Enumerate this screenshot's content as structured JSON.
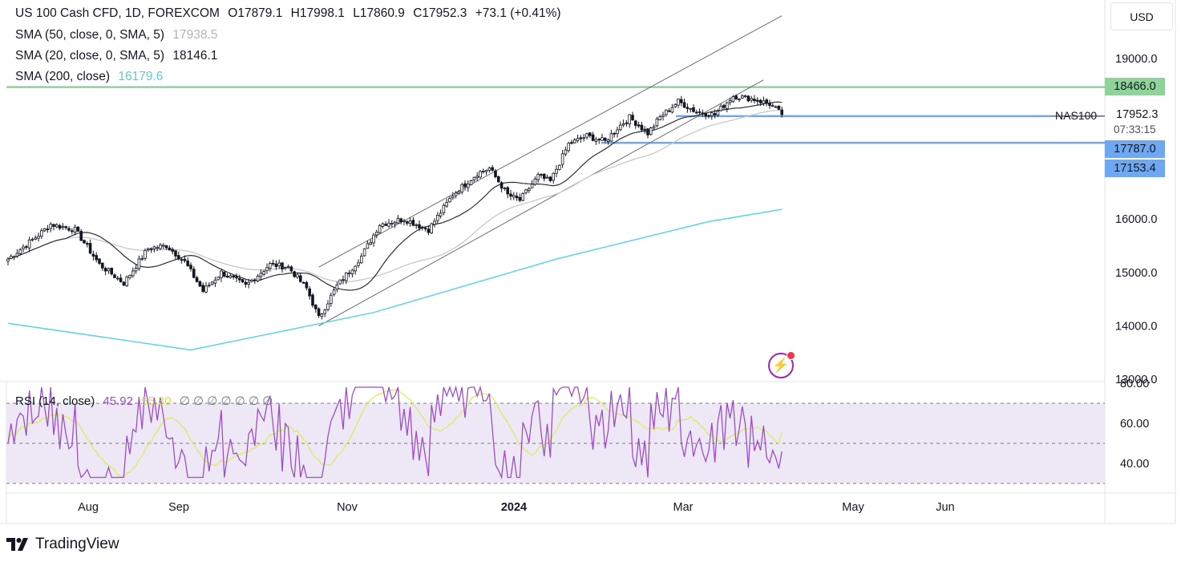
{
  "header": {
    "symbol": "US 100 Cash CFD, 1D, FOREXCOM",
    "open": "O17879.1",
    "high": "H17998.1",
    "low": "L17860.9",
    "close": "C17952.3",
    "change": "+73.1 (+0.41%)",
    "sma50_label": "SMA (50, close, 0, SMA, 5)",
    "sma50_value": "17938.5",
    "sma20_label": "SMA (20, close, 0, SMA, 5)",
    "sma20_value": "18146.1",
    "sma200_label": "SMA (200, close)",
    "sma200_value": "16179.6"
  },
  "rsi_legend": {
    "label": "RSI (14, close)",
    "rsi_value": "45.92",
    "ma_value": "55.30",
    "empty_values": "∅ ∅ ∅ ∅ ∅ ∅ ∅"
  },
  "currency_button": "USD",
  "price_tags": {
    "resistance": "18466.0",
    "last_price": "17952.3",
    "countdown": "07:33:15",
    "support1": "17787.0",
    "support2": "17153.4",
    "symbol_label": "NAS100"
  },
  "price_axis": [
    "19000.0",
    "16000.0",
    "15000.0",
    "14000.0",
    "13000.0"
  ],
  "rsi_axis": [
    "80.00",
    "60.00",
    "40.00"
  ],
  "time_axis": [
    "Aug",
    "Sep",
    "Nov",
    "2024",
    "Mar",
    "May",
    "Jun"
  ],
  "branding": "TradingView",
  "colors": {
    "up": "#131722",
    "down": "#131722",
    "sma20": "#2a2e39",
    "sma50": "#c8c8c8",
    "sma200": "#5dd3e8",
    "resistance": "#8fd39a",
    "support": "#6fa8f0",
    "rsi": "#9c4fc4",
    "rsi_ma": "#dcec5c",
    "rsi_band": "#ede7f6"
  },
  "chart_data": {
    "type": "candlestick",
    "title": "US 100 Cash CFD, 1D, FOREXCOM",
    "y_range": [
      12900,
      19500
    ],
    "x_labels": [
      "Aug",
      "Sep",
      "Nov",
      "2024",
      "Mar",
      "May",
      "Jun"
    ],
    "anchors": [
      {
        "i": 0,
        "c": 15250
      },
      {
        "i": 10,
        "c": 15700
      },
      {
        "i": 14,
        "c": 15900
      },
      {
        "i": 22,
        "c": 15800
      },
      {
        "i": 30,
        "c": 15150
      },
      {
        "i": 38,
        "c": 14800
      },
      {
        "i": 46,
        "c": 15450
      },
      {
        "i": 52,
        "c": 15500
      },
      {
        "i": 58,
        "c": 15200
      },
      {
        "i": 64,
        "c": 14650
      },
      {
        "i": 70,
        "c": 15000
      },
      {
        "i": 78,
        "c": 14750
      },
      {
        "i": 86,
        "c": 15150
      },
      {
        "i": 92,
        "c": 15100
      },
      {
        "i": 98,
        "c": 14700
      },
      {
        "i": 102,
        "c": 14150
      },
      {
        "i": 108,
        "c": 14750
      },
      {
        "i": 116,
        "c": 15300
      },
      {
        "i": 122,
        "c": 15900
      },
      {
        "i": 130,
        "c": 16000
      },
      {
        "i": 138,
        "c": 15800
      },
      {
        "i": 146,
        "c": 16450
      },
      {
        "i": 154,
        "c": 16850
      },
      {
        "i": 158,
        "c": 16950
      },
      {
        "i": 164,
        "c": 16450
      },
      {
        "i": 168,
        "c": 16350
      },
      {
        "i": 174,
        "c": 16800
      },
      {
        "i": 178,
        "c": 16700
      },
      {
        "i": 184,
        "c": 17400
      },
      {
        "i": 190,
        "c": 17550
      },
      {
        "i": 196,
        "c": 17450
      },
      {
        "i": 200,
        "c": 17700
      },
      {
        "i": 204,
        "c": 17900
      },
      {
        "i": 210,
        "c": 17600
      },
      {
        "i": 214,
        "c": 17900
      },
      {
        "i": 220,
        "c": 18200
      },
      {
        "i": 226,
        "c": 18000
      },
      {
        "i": 232,
        "c": 17950
      },
      {
        "i": 238,
        "c": 18300
      },
      {
        "i": 244,
        "c": 18250
      },
      {
        "i": 250,
        "c": 18150
      },
      {
        "i": 254,
        "c": 17952.3
      }
    ],
    "sma200": [
      [
        0,
        14050
      ],
      [
        60,
        13550
      ],
      [
        120,
        14250
      ],
      [
        180,
        15250
      ],
      [
        230,
        15950
      ],
      [
        254,
        16179.6
      ]
    ],
    "levels": {
      "resistance": 18466.0,
      "support1": 17787.0,
      "support2": 17153.4,
      "last": 17952.3
    },
    "channel": {
      "upper": [
        [
          102,
          15100
        ],
        [
          254,
          19800
        ]
      ],
      "lower": [
        [
          102,
          14000
        ],
        [
          248,
          18600
        ]
      ]
    },
    "rsi": {
      "y_range": [
        25,
        82
      ],
      "overbought": 70,
      "middle": 50,
      "oversold": 30,
      "last": 45.92,
      "ma_last": 55.3
    }
  }
}
